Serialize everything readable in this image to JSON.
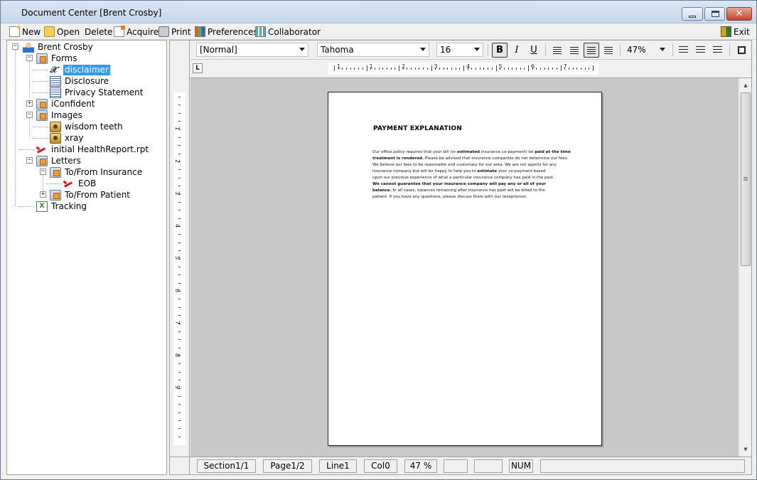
{
  "window": {
    "title": "Document Center [Brent Crosby]",
    "close_glyph": "✕"
  },
  "toolbar": {
    "new": "New",
    "open": "Open",
    "delete": "Delete",
    "acquire": "Acquire",
    "print": "Print",
    "preferences": "Preferences",
    "collaborator": "Collaborator",
    "exit": "Exit"
  },
  "tree": {
    "root": "Brent Crosby",
    "forms": "Forms",
    "disclaimer": "disclaimer",
    "disclosure": "Disclosure",
    "privacy": "Privacy Statement",
    "iconfident": "iConfident",
    "images": "Images",
    "wisdom_teeth": "wisdom teeth",
    "xray": "xray",
    "health_report": "initial HealthReport.rpt",
    "letters": "Letters",
    "to_from_insurance": "To/From Insurance",
    "eob": "EOB",
    "to_from_patient": "To/From Patient",
    "tracking": "Tracking",
    "minus": "−",
    "plus": "+"
  },
  "format": {
    "style": "[Normal]",
    "font": "Tahoma",
    "size": "16",
    "bold": "B",
    "italic": "I",
    "underline": "U",
    "zoom": "47%"
  },
  "ruler": {
    "h_numbers": [
      "1",
      "1",
      "2",
      "3",
      "4",
      "5",
      "6",
      "7"
    ],
    "v_numbers": [
      "1",
      "2",
      "3",
      "4",
      "5",
      "6",
      "7",
      "8",
      "9"
    ],
    "tab_marker": "L"
  },
  "document": {
    "title": "PAYMENT EXPLANATION",
    "lines": [
      [
        {
          "t": "Our office policy requires that your  bill (or "
        },
        {
          "t": "estimated",
          "b": true
        },
        {
          "t": " insurance  co-payment) be  "
        },
        {
          "t": "paid at the time",
          "b": true
        }
      ],
      [
        {
          "t": "treatment is  rendered.",
          "b": true
        },
        {
          "t": "  Please  be  advised that  insurance  companies do not  determine our fees."
        }
      ],
      [
        {
          "t": "We believe our fees to be reasonable  and customary for  our area.  We are  not agents for any"
        }
      ],
      [
        {
          "t": "insurance company  but will  be happy to  help you to  "
        },
        {
          "t": "estimate",
          "b": true
        },
        {
          "t": "  your  co-payment based"
        }
      ],
      [
        {
          "t": "upon our previous experience of what  a particular  insurance company  has paid in the past."
        }
      ],
      [
        {
          "t": "We cannot  guarantee that  your  insurance company  will pay  any or  all of your",
          "b": true
        }
      ],
      [
        {
          "t": "balance.",
          "b": true
        },
        {
          "t": "  In all  cases, balances  remaining after  insurance has paid  will  be billed to the"
        }
      ],
      [
        {
          "t": "patient.  If you have  any questions,  please discuss them  with our  receptionist."
        }
      ]
    ]
  },
  "status": {
    "section": "Section1/1",
    "page": "Page1/2",
    "line": "Line1",
    "col": "Col0",
    "zoom": "47 %",
    "num": "NUM"
  }
}
